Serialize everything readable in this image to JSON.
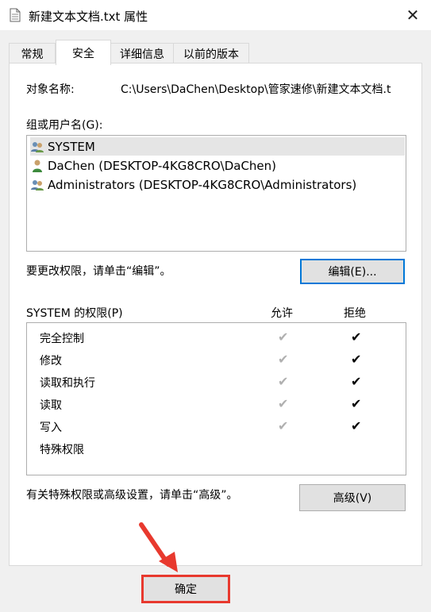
{
  "window": {
    "title": "新建文本文档.txt 属性",
    "close_glyph": "✕"
  },
  "tabs": [
    {
      "label": "常规"
    },
    {
      "label": "安全"
    },
    {
      "label": "详细信息"
    },
    {
      "label": "以前的版本"
    }
  ],
  "object": {
    "label": "对象名称:",
    "value": "C:\\Users\\DaChen\\Desktop\\管家速修\\新建文本文档.t"
  },
  "groups": {
    "label": "组或用户名(G):",
    "items": [
      {
        "name": "SYSTEM",
        "icon": "group-users-icon"
      },
      {
        "name": "DaChen (DESKTOP-4KG8CRO\\DaChen)",
        "icon": "user-icon"
      },
      {
        "name": "Administrators (DESKTOP-4KG8CRO\\Administrators)",
        "icon": "group-users-icon"
      }
    ]
  },
  "edit_hint": "要更改权限，请单击“编辑”。",
  "edit_button": "编辑(E)...",
  "permissions": {
    "label": "SYSTEM 的权限(P)",
    "allow_header": "允许",
    "deny_header": "拒绝",
    "rows": [
      {
        "name": "完全控制",
        "allow": true,
        "deny": true
      },
      {
        "name": "修改",
        "allow": true,
        "deny": true
      },
      {
        "name": "读取和执行",
        "allow": true,
        "deny": true
      },
      {
        "name": "读取",
        "allow": true,
        "deny": true
      },
      {
        "name": "写入",
        "allow": true,
        "deny": true
      },
      {
        "name": "特殊权限",
        "allow": false,
        "deny": false
      }
    ],
    "check_glyph": "✔"
  },
  "advanced_hint": "有关特殊权限或高级设置，请单击“高级”。",
  "advanced_button": "高级(V)",
  "ok_button": "确定",
  "colors": {
    "highlight": "#e8392e",
    "focus": "#0078d7"
  }
}
